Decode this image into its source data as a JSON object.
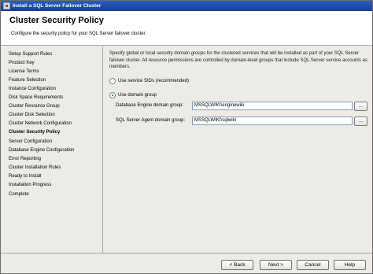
{
  "window": {
    "title": "Install a SQL Server Failover Cluster"
  },
  "header": {
    "title": "Cluster Security Policy",
    "subtitle": "Configure the security policy for your SQL Server failover cluster."
  },
  "sidebar": {
    "items": [
      {
        "label": "Setup Support Rules"
      },
      {
        "label": "Product Key"
      },
      {
        "label": "License Terms"
      },
      {
        "label": "Feature Selection"
      },
      {
        "label": "Instance Configuration"
      },
      {
        "label": "Disk Space Requirements"
      },
      {
        "label": "Cluster Resource Group"
      },
      {
        "label": "Cluster Disk Selection"
      },
      {
        "label": "Cluster Network Configuration"
      },
      {
        "label": "Cluster Security Policy"
      },
      {
        "label": "Server Configuration"
      },
      {
        "label": "Database Engine Configuration"
      },
      {
        "label": "Error Reporting"
      },
      {
        "label": "Cluster Installation Rules"
      },
      {
        "label": "Ready to Install"
      },
      {
        "label": "Installation Progress"
      },
      {
        "label": "Complete"
      }
    ],
    "active_label": "Cluster Security Policy"
  },
  "main": {
    "description": "Specify global or local security domain groups for the clustered services that will be installed as part of your SQL Server failover cluster. All resource permissions are controlled by domain-level groups that include SQL Server service accounts as members.",
    "option_sids": "Use service SIDs (recommended)",
    "option_domain": "Use domain group",
    "selected_option": "Use domain group",
    "db_engine_label": "Database Engine domain group:",
    "db_engine_value": "MSSQLWIKI\\enginewiki",
    "agent_label": "SQL Server Agent domain group:",
    "agent_value": "MSSQLWIKI\\sqlwiki",
    "browse_label": "..."
  },
  "footer": {
    "back_label": "< Back",
    "next_label": "Next >",
    "cancel_label": "Cancel",
    "help_label": "Help"
  }
}
